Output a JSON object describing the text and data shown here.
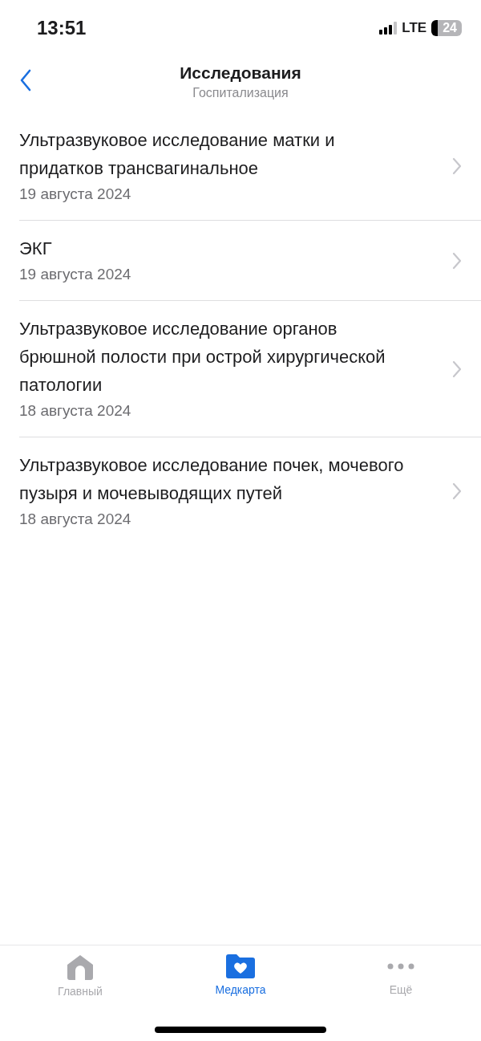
{
  "status_bar": {
    "time": "13:51",
    "network": "LTE",
    "battery": "24"
  },
  "header": {
    "title": "Исследования",
    "subtitle": "Госпитализация"
  },
  "items": [
    {
      "title": "Ультразвуковое исследование матки и придатков трансвагинальное",
      "date": "19 августа 2024"
    },
    {
      "title": "ЭКГ",
      "date": "19 августа 2024"
    },
    {
      "title": "Ультразвуковое исследование органов брюшной полости при острой хирургической патологии",
      "date": "18 августа 2024"
    },
    {
      "title": "Ультразвуковое исследование почек, мочевого пузыря и мочевыводящих путей",
      "date": "18 августа 2024"
    }
  ],
  "tab_bar": [
    {
      "label": "Главный",
      "kind": "home",
      "selected": false
    },
    {
      "label": "Медкарта",
      "kind": "medcard",
      "selected": true
    },
    {
      "label": "Ещё",
      "kind": "more",
      "selected": false
    }
  ]
}
